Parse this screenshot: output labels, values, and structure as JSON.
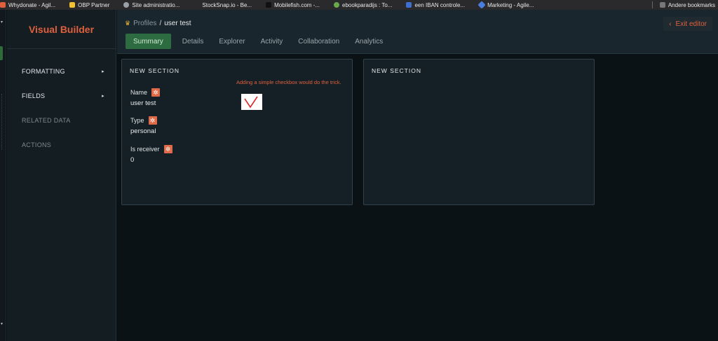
{
  "bookmarks": [
    {
      "label": "Whydonate - Agil...",
      "color": "#e0603d"
    },
    {
      "label": "OBP Partner",
      "color": "#f2c230"
    },
    {
      "label": "Site administratio...",
      "color": "#9aa0a6"
    },
    {
      "label": "StockSnap.io - Be...",
      "color": "#2a2a2c"
    },
    {
      "label": "Mobilefish.com -...",
      "color": "#111111"
    },
    {
      "label": "ebookparadijs : To...",
      "color": "#6aa84f"
    },
    {
      "label": "een IBAN controle...",
      "color": "#3d6fd1"
    },
    {
      "label": "Marketing - Agile...",
      "color": "#4a7de0"
    }
  ],
  "other_bookmarks": "Andere bookmarks",
  "sidebar": {
    "title": "Visual Builder",
    "items": [
      {
        "label": "FORMATTING",
        "arrow": "▸"
      },
      {
        "label": "FIELDS",
        "arrow": "▸"
      },
      {
        "label": "RELATED DATA"
      },
      {
        "label": "ACTIONS"
      }
    ]
  },
  "header": {
    "breadcrumb_root": "Profiles",
    "breadcrumb_sep": "/",
    "breadcrumb_current": "user test",
    "exit_label": "Exit editor",
    "tabs": [
      "Summary",
      "Details",
      "Explorer",
      "Activity",
      "Collaboration",
      "Analytics"
    ]
  },
  "sections": [
    {
      "title": "NEW SECTION",
      "note": "Adding a simple checkbox would do the trick.",
      "fields": [
        {
          "label": "Name",
          "value": "user test"
        },
        {
          "label": "Type",
          "value": "personal"
        },
        {
          "label": "Is receiver",
          "value": "0"
        }
      ]
    },
    {
      "title": "NEW SECTION"
    }
  ],
  "colors": {
    "accent": "#e0603d",
    "active_tab": "#2d6b40",
    "background": "#0b1216"
  }
}
